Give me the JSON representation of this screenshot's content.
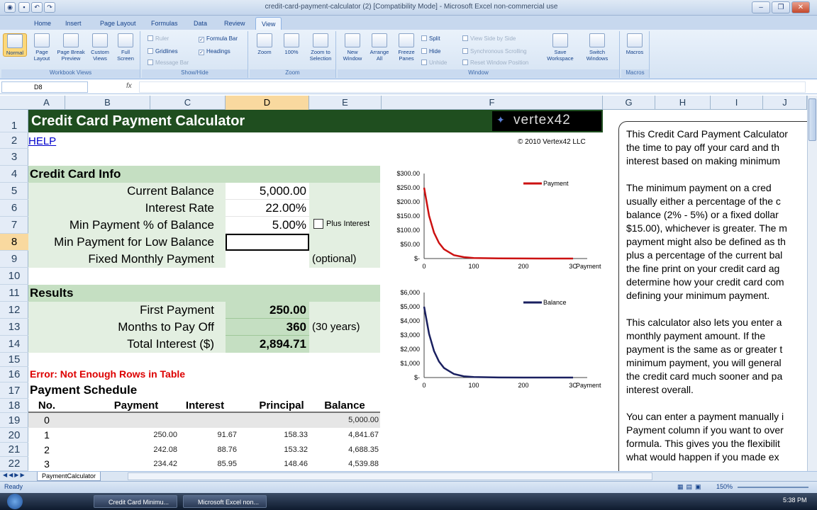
{
  "window": {
    "title": "credit-card-payment-calculator (2) [Compatibility Mode] - Microsoft Excel non-commercial use"
  },
  "ribbon": {
    "tabs": [
      "Home",
      "Insert",
      "Page Layout",
      "Formulas",
      "Data",
      "Review",
      "View"
    ],
    "active_tab": "View",
    "workbook_views": {
      "label": "Workbook Views",
      "buttons": [
        "Normal",
        "Page Layout",
        "Page Break Preview",
        "Custom Views",
        "Full Screen"
      ]
    },
    "show_hide": {
      "label": "Show/Hide",
      "ruler": "Ruler",
      "gridlines": "Gridlines",
      "message_bar": "Message Bar",
      "formula_bar": "Formula Bar",
      "headings": "Headings"
    },
    "zoom": {
      "label": "Zoom",
      "buttons": [
        "Zoom",
        "100%",
        "Zoom to Selection"
      ]
    },
    "window_group": {
      "label": "Window",
      "buttons": [
        "New Window",
        "Arrange All",
        "Freeze Panes"
      ],
      "split": "Split",
      "hide": "Hide",
      "unhide": "Unhide",
      "side_by_side": "View Side by Side",
      "sync_scroll": "Synchronous Scrolling",
      "reset_pos": "Reset Window Position",
      "save_ws": "Save Workspace",
      "switch": "Switch Windows"
    },
    "macros": {
      "label": "Macros",
      "button": "Macros"
    }
  },
  "formula_bar": {
    "name_box": "D8",
    "fx": "fx",
    "content": ""
  },
  "columns": [
    "A",
    "B",
    "C",
    "D",
    "E",
    "F",
    "G",
    "H",
    "I",
    "J"
  ],
  "rows": [
    "1",
    "2",
    "3",
    "4",
    "5",
    "6",
    "7",
    "8",
    "9",
    "10",
    "11",
    "12",
    "13",
    "14",
    "15",
    "16",
    "17",
    "18",
    "19",
    "20",
    "21",
    "22"
  ],
  "sheet": {
    "title": "Credit Card Payment Calculator",
    "logo": "vertex42",
    "help": "HELP",
    "copyright": "© 2010 Vertex42 LLC",
    "info_header": "Credit Card Info",
    "inputs": [
      {
        "label": "Current Balance",
        "value": "5,000.00"
      },
      {
        "label": "Interest Rate",
        "value": "22.00%"
      },
      {
        "label": "Min Payment % of Balance",
        "value": "5.00%"
      },
      {
        "label": "Min Payment for Low Balance",
        "value": ""
      },
      {
        "label": "Fixed Monthly Payment",
        "value": ""
      }
    ],
    "plus_interest": "Plus Interest",
    "optional": "(optional)",
    "results_header": "Results",
    "results": [
      {
        "label": "First Payment",
        "value": "250.00"
      },
      {
        "label": "Months to Pay Off",
        "value": "360"
      },
      {
        "label": "Total Interest ($)",
        "value": "2,894.71"
      }
    ],
    "months_note": "(30 years)",
    "error": "Error: Not Enough Rows in Table",
    "schedule_header": "Payment Schedule",
    "schedule_cols": [
      "No.",
      "Payment",
      "Interest",
      "Principal",
      "Balance"
    ],
    "schedule_rows": [
      [
        "0",
        "",
        "",
        "",
        "5,000.00"
      ],
      [
        "1",
        "250.00",
        "91.67",
        "158.33",
        "4,841.67"
      ],
      [
        "2",
        "242.08",
        "88.76",
        "153.32",
        "4,688.35"
      ],
      [
        "3",
        "234.42",
        "85.95",
        "148.46",
        "4,539.88"
      ]
    ]
  },
  "note": {
    "paragraphs": [
      [
        "This Credit Card Payment Calculator",
        "the time to pay off your card and th",
        "interest based on making minimum"
      ],
      [
        "The minimum payment on a cred",
        "usually either a percentage of the c",
        "balance (2% - 5%) or a fixed dollar",
        "$15.00), whichever is greater. The m",
        "payment might also be defined as th",
        "plus a percentage of the current bal",
        "the fine print on your credit card ag",
        "determine how your credit card com",
        "defining your minimum payment."
      ],
      [
        "This calculator also lets you enter a",
        "monthly payment amount. If the",
        "payment is the same as or greater t",
        "minimum payment, you will general",
        "the credit card much sooner and pa",
        "interest overall."
      ],
      [
        "You can enter a payment manually i",
        "Payment column if you want to over",
        "formula. This gives you the flexibilit",
        "what would happen if you made ex"
      ]
    ]
  },
  "sheet_tab": "PaymentCalculator",
  "status": {
    "ready": "Ready",
    "zoom": "150%"
  },
  "taskbar": {
    "items": [
      "Credit Card Minimu...",
      "Microsoft Excel non..."
    ],
    "clock": "5:38 PM"
  },
  "chart_data": [
    {
      "type": "line",
      "series": [
        {
          "name": "Payment",
          "color": "#cc1111"
        }
      ],
      "x": [
        0,
        10,
        20,
        30,
        40,
        60,
        80,
        100,
        150,
        200,
        250,
        300,
        360
      ],
      "y": [
        250,
        151,
        91,
        55,
        33,
        12,
        5,
        2,
        0.5,
        0.2,
        0.1,
        0.1,
        0.1
      ],
      "x_ticks": [
        "0",
        "100",
        "200",
        "3C"
      ],
      "y_ticks": [
        "$-",
        "$50.00",
        "$100.00",
        "$150.00",
        "$200.00",
        "$250.00",
        "$300.00"
      ],
      "xlabel": "Payment No.",
      "ylim": [
        0,
        300
      ],
      "xlim": [
        0,
        300
      ]
    },
    {
      "type": "line",
      "series": [
        {
          "name": "Balance",
          "color": "#1a2060"
        }
      ],
      "x": [
        0,
        10,
        20,
        30,
        40,
        60,
        80,
        100,
        150,
        200,
        250,
        300,
        360
      ],
      "y": [
        5000,
        3080,
        1870,
        1130,
        680,
        250,
        90,
        35,
        5,
        1,
        0,
        0,
        0
      ],
      "x_ticks": [
        "0",
        "100",
        "200",
        "3C"
      ],
      "y_ticks": [
        "$-",
        "$1,000",
        "$2,000",
        "$3,000",
        "$4,000",
        "$5,000",
        "$6,000"
      ],
      "xlabel": "Payment No.",
      "ylim": [
        0,
        6000
      ],
      "xlim": [
        0,
        300
      ]
    }
  ]
}
